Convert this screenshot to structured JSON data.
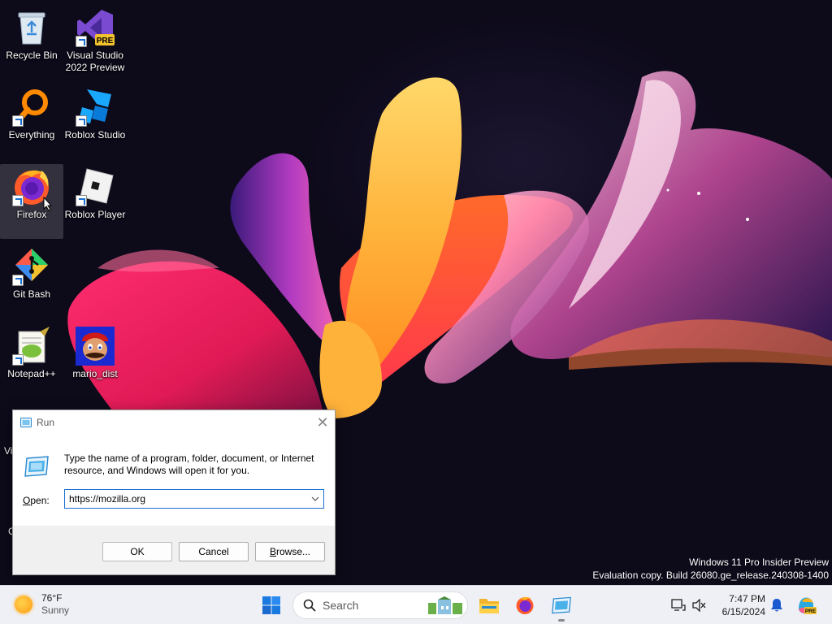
{
  "desktop": {
    "icons": [
      {
        "label": "Recycle Bin"
      },
      {
        "label": "Visual Studio 2022 Preview",
        "badge": "PRE"
      },
      {
        "label": "Everything"
      },
      {
        "label": "Roblox Studio"
      },
      {
        "label": "Firefox"
      },
      {
        "label": "Roblox Player"
      },
      {
        "label": "Git Bash"
      },
      {
        "label": "Notepad++"
      },
      {
        "label": "mario_dist"
      }
    ],
    "partial_labels": [
      "Vi",
      "C"
    ]
  },
  "run_dialog": {
    "title": "Run",
    "description": "Type the name of a program, folder, document, or Internet resource, and Windows will open it for you.",
    "open_label_prefix": "O",
    "open_label_rest": "pen:",
    "open_value": "https://mozilla.org",
    "ok_label": "OK",
    "cancel_label": "Cancel",
    "browse_label_prefix": "B",
    "browse_label_rest": "rowse...",
    "close_glyph": "✕"
  },
  "watermark": {
    "line1": "Windows 11 Pro Insider Preview",
    "line2": "Evaluation copy. Build 26080.ge_release.240308-1400"
  },
  "taskbar": {
    "weather_temp": "76°F",
    "weather_condition": "Sunny",
    "search_placeholder": "Search",
    "time": "7:47 PM",
    "date": "6/15/2024",
    "copilot_badge": "PRE"
  },
  "colors": {
    "accent": "#1a6fd0",
    "taskbar_bg": "#eef0f5",
    "dialog_bg": "#f0f0f0"
  }
}
